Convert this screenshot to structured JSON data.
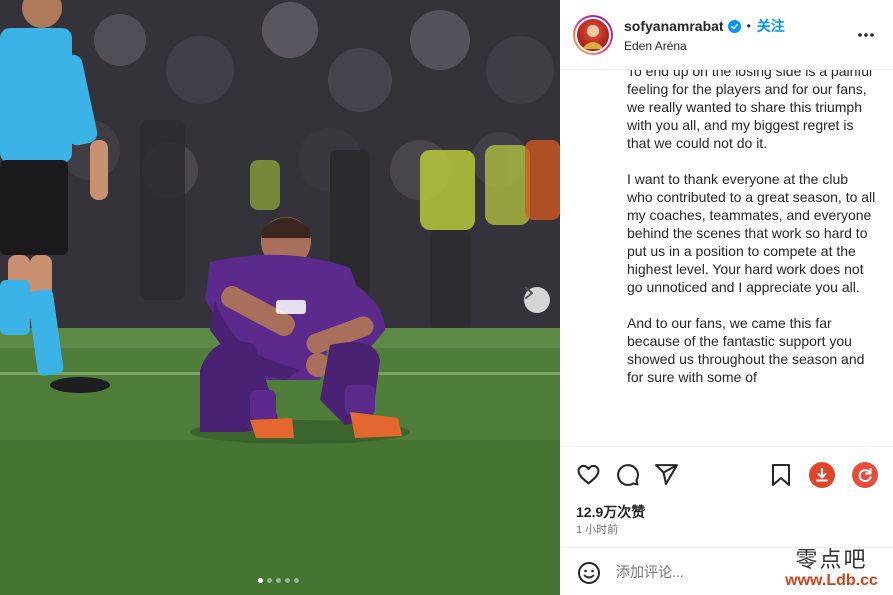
{
  "post": {
    "username": "sofyanamrabat",
    "separator": "•",
    "follow_label": "关注",
    "location": "Eden Aréna",
    "caption_paragraphs": [
      "To end up on the losing side is a painful feeling for the players and for our fans, we really wanted to share this triumph with you all, and my biggest regret is that we could not do it.",
      "I want to thank everyone at the club who contributed to a great season, to all my coaches, teammates, and everyone behind the scenes that work so hard to put us in a position to compete at the highest level. Your hard work does not go unnoticed and I appreciate you all.",
      "And to our fans, we came this far because of the fantastic support you showed us throughout the season and for sure with some of"
    ],
    "likes": "12.9万次赞",
    "time_ago": "1 小时前",
    "comment_placeholder": "添加评论..."
  },
  "carousel": {
    "slide_count": 5,
    "active_index": 0
  },
  "icons": {
    "like": "heart-icon",
    "comment": "comment-icon",
    "share": "share-icon",
    "save": "bookmark-icon",
    "download": "download-icon",
    "refresh": "refresh-icon",
    "emoji": "emoji-icon",
    "more": "more-icon",
    "verified": "verified-badge-icon",
    "next": "chevron-right-icon"
  },
  "colors": {
    "follow_blue": "#0095f6",
    "verified_blue": "#0095f6",
    "download_red": "#e0452b",
    "refresh_red": "#e84c3d",
    "jersey_purple": "#5b2a8c",
    "grass_green": "#4f7d3a"
  },
  "watermark": {
    "line1": "零点吧",
    "line2": "www.Ldb.cc"
  }
}
